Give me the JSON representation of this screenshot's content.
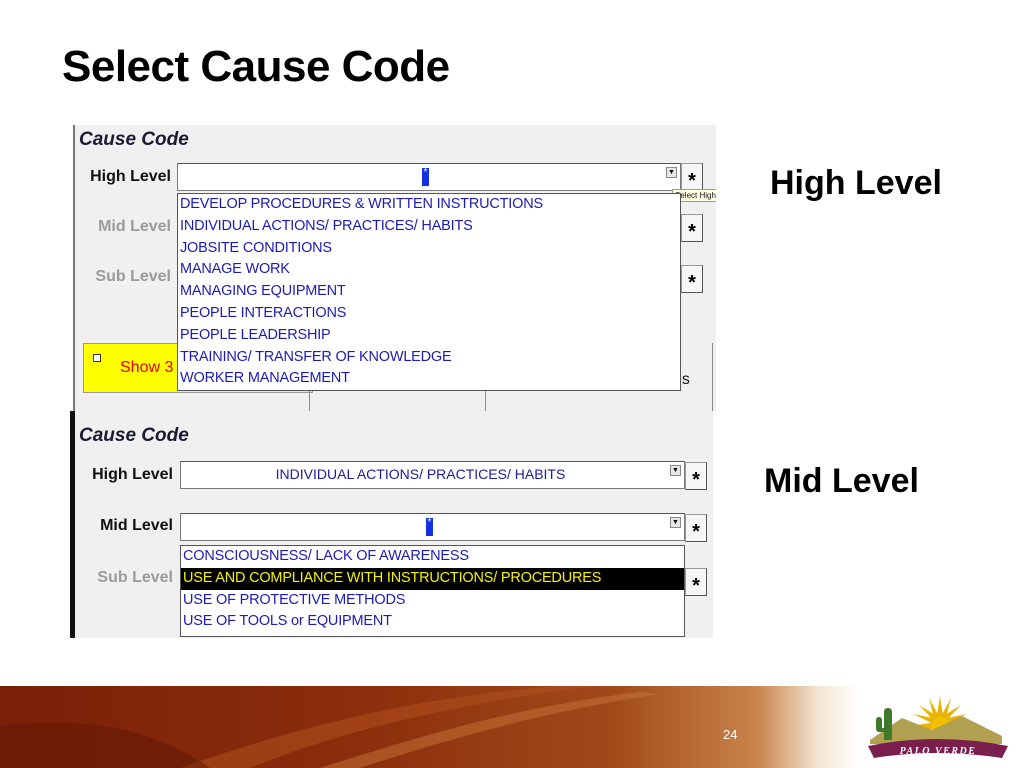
{
  "slide": {
    "title": "Select Cause Code",
    "high_level_heading": "High Level",
    "mid_level_heading": "Mid Level",
    "page_number": "24",
    "logo_text": "PALO VERDE"
  },
  "panel1": {
    "title": "Cause Code",
    "labels": {
      "high": "High Level",
      "mid": "Mid Level",
      "sub": "Sub Level"
    },
    "high_value": "",
    "star": "*",
    "tooltip": "Select High",
    "dropdown_options": [
      "DEVELOP PROCEDURES & WRITTEN INSTRUCTIONS",
      "INDIVIDUAL ACTIONS/ PRACTICES/ HABITS",
      "JOBSITE CONDITIONS",
      "MANAGE WORK",
      "MANAGING EQUIPMENT",
      "PEOPLE INTERACTIONS",
      "PEOPLE LEADERSHIP",
      "TRAINING/ TRANSFER OF KNOWLEDGE",
      "WORKER MANAGEMENT"
    ],
    "show_label": "Show 3",
    "trailing_fragment": "es"
  },
  "panel2": {
    "title": "Cause Code",
    "labels": {
      "high": "High Level",
      "mid": "Mid Level",
      "sub": "Sub Level"
    },
    "high_value": "INDIVIDUAL ACTIONS/ PRACTICES/ HABITS",
    "mid_value": "",
    "star": "*",
    "dropdown_options": [
      "CONSCIOUSNESS/ LACK OF AWARENESS",
      "USE AND COMPLIANCE WITH INSTRUCTIONS/ PROCEDURES",
      "USE OF PROTECTIVE METHODS",
      "USE OF TOOLS or EQUIPMENT"
    ],
    "selected_option": "USE AND COMPLIANCE WITH INSTRUCTIONS/ PROCEDURES"
  },
  "colors": {
    "option_text": "#1c1cb4",
    "selected_bg": "#000000",
    "selected_text": "#f5f200",
    "caret": "#1230e0",
    "show_text": "#e60000",
    "show_bg": "#ffff00"
  }
}
